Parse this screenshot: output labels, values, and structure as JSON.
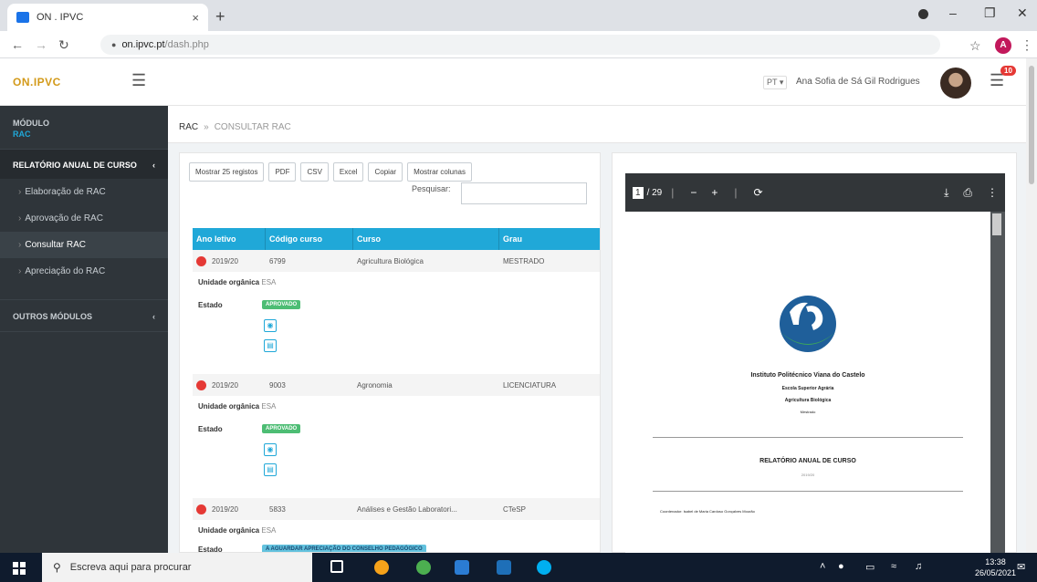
{
  "browser": {
    "tab_title": "ON . IPVC",
    "tab_close": "×",
    "new_tab": "+",
    "url_host": "on.ipvc.pt",
    "url_path": "/dash.php",
    "profile_initial": "A"
  },
  "header": {
    "brand": "ON.IPVC",
    "lang": "PT ▾",
    "user_name": "Ana Sofia de Sá Gil Rodrigues",
    "notif_count": "10"
  },
  "sidebar": {
    "modulo_label": "MÓDULO",
    "modulo_value": "RAC",
    "section": "RELATÓRIO ANUAL DE CURSO",
    "items": [
      {
        "label": "Elaboração de RAC"
      },
      {
        "label": "Aprovação de RAC"
      },
      {
        "label": "Consultar RAC"
      },
      {
        "label": "Apreciação do RAC"
      }
    ],
    "outros": "OUTROS MÓDULOS"
  },
  "breadcrumb": {
    "root": "RAC",
    "sep": "»",
    "current": "CONSULTAR RAC"
  },
  "toolbar": {
    "buttons": [
      "Mostrar 25 registos",
      "PDF",
      "CSV",
      "Excel",
      "Copiar",
      "Mostrar colunas"
    ],
    "search_label": "Pesquisar:"
  },
  "table": {
    "headers": [
      "Ano letivo",
      "Código curso",
      "Curso",
      "Grau"
    ],
    "unit_label": "Unidade orgânica",
    "state_label": "Estado",
    "rows": [
      {
        "ano": "2019/20",
        "codigo": "6799",
        "curso": "Agricultura Biológica",
        "grau": "MESTRADO",
        "unidade": "ESA",
        "estado": "APROVADO"
      },
      {
        "ano": "2019/20",
        "codigo": "9003",
        "curso": "Agronomia",
        "grau": "LICENCIATURA",
        "unidade": "ESA",
        "estado": "APROVADO"
      },
      {
        "ano": "2019/20",
        "codigo": "5833",
        "curso": "Análises e Gestão Laboratori...",
        "grau": "CTeSP",
        "unidade": "ESA",
        "estado": "A AGUARDAR APRECIAÇÃO DO CONSELHO PEDAGÓGICO"
      }
    ]
  },
  "pdf": {
    "page": "1",
    "of": "/ 29",
    "institution": "Instituto Politécnico Viana do Castelo",
    "school": "Escola Superior Agrária",
    "course": "Agricultura Biológica",
    "degree": "Mestrado",
    "report_title": "RELATÓRIO ANUAL DE CURSO",
    "year": "2019/20",
    "coordinator": "Coordenador: Isabel de Maria Cardoso Gonçalves Mourão"
  },
  "taskbar": {
    "search_placeholder": "Escreva aqui para procurar",
    "time": "13:38",
    "date": "26/05/2021"
  },
  "colors": {
    "accent": "#20a8d8",
    "sidebar": "#2f353a",
    "success": "#4dbd74",
    "danger": "#e53935",
    "brand": "#d39a1a"
  }
}
